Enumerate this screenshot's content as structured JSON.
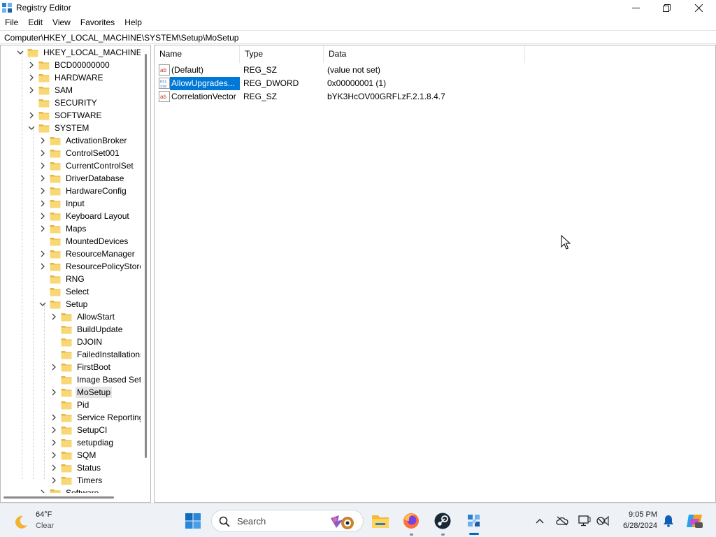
{
  "window": {
    "title": "Registry Editor"
  },
  "menu": [
    "File",
    "Edit",
    "View",
    "Favorites",
    "Help"
  ],
  "address": "Computer\\HKEY_LOCAL_MACHINE\\SYSTEM\\Setup\\MoSetup",
  "tree": [
    {
      "label": "HKEY_LOCAL_MACHINE",
      "level": 0,
      "expand": "open"
    },
    {
      "label": "BCD00000000",
      "level": 1,
      "expand": "closed"
    },
    {
      "label": "HARDWARE",
      "level": 1,
      "expand": "closed"
    },
    {
      "label": "SAM",
      "level": 1,
      "expand": "closed"
    },
    {
      "label": "SECURITY",
      "level": 1,
      "expand": "none"
    },
    {
      "label": "SOFTWARE",
      "level": 1,
      "expand": "closed"
    },
    {
      "label": "SYSTEM",
      "level": 1,
      "expand": "open"
    },
    {
      "label": "ActivationBroker",
      "level": 2,
      "expand": "closed"
    },
    {
      "label": "ControlSet001",
      "level": 2,
      "expand": "closed"
    },
    {
      "label": "CurrentControlSet",
      "level": 2,
      "expand": "closed"
    },
    {
      "label": "DriverDatabase",
      "level": 2,
      "expand": "closed"
    },
    {
      "label": "HardwareConfig",
      "level": 2,
      "expand": "closed"
    },
    {
      "label": "Input",
      "level": 2,
      "expand": "closed"
    },
    {
      "label": "Keyboard Layout",
      "level": 2,
      "expand": "closed"
    },
    {
      "label": "Maps",
      "level": 2,
      "expand": "closed"
    },
    {
      "label": "MountedDevices",
      "level": 2,
      "expand": "none"
    },
    {
      "label": "ResourceManager",
      "level": 2,
      "expand": "closed"
    },
    {
      "label": "ResourcePolicyStore",
      "level": 2,
      "expand": "closed"
    },
    {
      "label": "RNG",
      "level": 2,
      "expand": "none"
    },
    {
      "label": "Select",
      "level": 2,
      "expand": "none"
    },
    {
      "label": "Setup",
      "level": 2,
      "expand": "open"
    },
    {
      "label": "AllowStart",
      "level": 3,
      "expand": "closed"
    },
    {
      "label": "BuildUpdate",
      "level": 3,
      "expand": "none"
    },
    {
      "label": "DJOIN",
      "level": 3,
      "expand": "none"
    },
    {
      "label": "FailedInstallations",
      "level": 3,
      "expand": "none"
    },
    {
      "label": "FirstBoot",
      "level": 3,
      "expand": "closed"
    },
    {
      "label": "Image Based Setup",
      "level": 3,
      "expand": "none"
    },
    {
      "label": "MoSetup",
      "level": 3,
      "expand": "closed",
      "selected": true
    },
    {
      "label": "Pid",
      "level": 3,
      "expand": "none"
    },
    {
      "label": "Service Reporting",
      "level": 3,
      "expand": "closed"
    },
    {
      "label": "SetupCI",
      "level": 3,
      "expand": "closed"
    },
    {
      "label": "setupdiag",
      "level": 3,
      "expand": "closed"
    },
    {
      "label": "SQM",
      "level": 3,
      "expand": "closed"
    },
    {
      "label": "Status",
      "level": 3,
      "expand": "closed"
    },
    {
      "label": "Timers",
      "level": 3,
      "expand": "closed"
    },
    {
      "label": "Software",
      "level": 2,
      "expand": "closed"
    }
  ],
  "list": {
    "columns": [
      "Name",
      "Type",
      "Data"
    ],
    "rows": [
      {
        "icon": "string-value-icon",
        "name": "(Default)",
        "type": "REG_SZ",
        "data": "(value not set)"
      },
      {
        "icon": "binary-value-icon",
        "name": "AllowUpgrades...",
        "type": "REG_DWORD",
        "data": "0x00000001 (1)",
        "selected": true
      },
      {
        "icon": "string-value-icon",
        "name": "CorrelationVector",
        "type": "REG_SZ",
        "data": "bYK3HcOV00GRFLzF.2.1.8.4.7"
      }
    ]
  },
  "taskbar": {
    "weather": {
      "temp": "64°F",
      "condition": "Clear"
    },
    "search_placeholder": "Search",
    "clock": {
      "time": "9:05 PM",
      "date": "6/28/2024"
    }
  },
  "colors": {
    "selection": "#0078d7",
    "folder": "#f8d775",
    "taskbar": "#eef2f7",
    "accent": "#0067c0"
  }
}
